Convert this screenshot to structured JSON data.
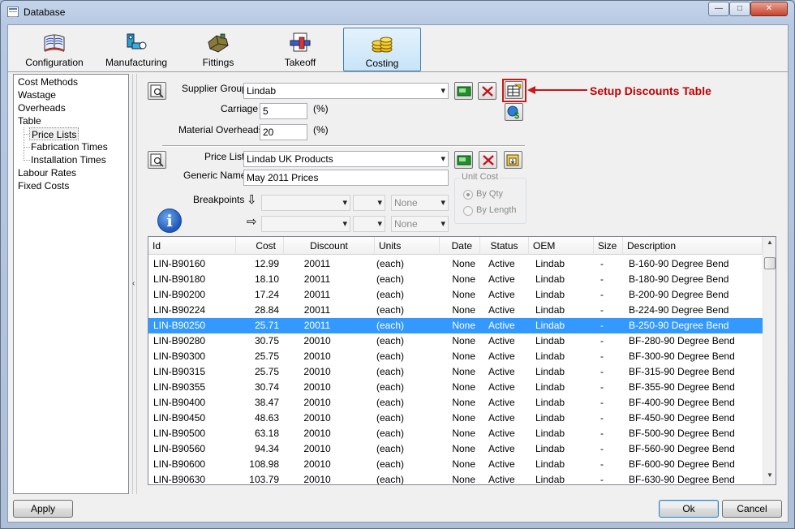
{
  "window": {
    "title": "Database",
    "min_glyph": "—",
    "max_glyph": "□",
    "close_glyph": "✕"
  },
  "toolbar": {
    "items": [
      {
        "label": "Configuration",
        "icon": "books-icon"
      },
      {
        "label": "Manufacturing",
        "icon": "manufacturing-icon"
      },
      {
        "label": "Fittings",
        "icon": "fittings-icon"
      },
      {
        "label": "Takeoff",
        "icon": "takeoff-icon"
      },
      {
        "label": "Costing",
        "icon": "coins-icon",
        "active": true
      }
    ]
  },
  "tree": {
    "items": [
      {
        "label": "Cost Methods"
      },
      {
        "label": "Wastage"
      },
      {
        "label": "Overheads"
      },
      {
        "label": "Table"
      },
      {
        "label": "Price Lists",
        "selected": true
      },
      {
        "label": "Fabrication Times"
      },
      {
        "label": "Installation Times"
      },
      {
        "label": "Labour Rates"
      },
      {
        "label": "Fixed Costs"
      }
    ],
    "splitter_glyph": "‹"
  },
  "supplier": {
    "group_label": "Supplier Group",
    "group_value": "Lindab",
    "carriage_label": "Carriage",
    "carriage_value": "5",
    "carriage_unit": "(%)",
    "overheads_label": "Material Overheads",
    "overheads_value": "20",
    "overheads_unit": "(%)"
  },
  "pricelist": {
    "label": "Price List",
    "value": "Lindab UK Products",
    "generic_label": "Generic Name",
    "generic_value": "May 2011 Prices",
    "breakpoints_label": "Breakpoints",
    "bp_down_glyph": "⇩",
    "bp_right_glyph": "⇨",
    "none1": "None",
    "none2": "None"
  },
  "unit_cost": {
    "title": "Unit Cost",
    "by_qty": "By Qty",
    "by_length": "By Length",
    "selected": "By Qty"
  },
  "info_glyph": "i",
  "grid": {
    "columns": [
      "Id",
      "Cost",
      "Discount",
      "Units",
      "Date",
      "Status",
      "OEM",
      "Size",
      "Description"
    ],
    "rows": [
      [
        "LIN-B90160",
        "12.99",
        "20011",
        "(each)",
        "None",
        "Active",
        "Lindab",
        "-",
        "B-160-90 Degree Bend"
      ],
      [
        "LIN-B90180",
        "18.10",
        "20011",
        "(each)",
        "None",
        "Active",
        "Lindab",
        "-",
        "B-180-90 Degree Bend"
      ],
      [
        "LIN-B90200",
        "17.24",
        "20011",
        "(each)",
        "None",
        "Active",
        "Lindab",
        "-",
        "B-200-90 Degree Bend"
      ],
      [
        "LIN-B90224",
        "28.84",
        "20011",
        "(each)",
        "None",
        "Active",
        "Lindab",
        "-",
        "B-224-90 Degree Bend"
      ],
      [
        "LIN-B90250",
        "25.71",
        "20011",
        "(each)",
        "None",
        "Active",
        "Lindab",
        "-",
        "B-250-90 Degree Bend"
      ],
      [
        "LIN-B90280",
        "30.75",
        "20010",
        "(each)",
        "None",
        "Active",
        "Lindab",
        "-",
        "BF-280-90 Degree Bend"
      ],
      [
        "LIN-B90300",
        "25.75",
        "20010",
        "(each)",
        "None",
        "Active",
        "Lindab",
        "-",
        "BF-300-90 Degree Bend"
      ],
      [
        "LIN-B90315",
        "25.75",
        "20010",
        "(each)",
        "None",
        "Active",
        "Lindab",
        "-",
        "BF-315-90 Degree Bend"
      ],
      [
        "LIN-B90355",
        "30.74",
        "20010",
        "(each)",
        "None",
        "Active",
        "Lindab",
        "-",
        "BF-355-90 Degree Bend"
      ],
      [
        "LIN-B90400",
        "38.47",
        "20010",
        "(each)",
        "None",
        "Active",
        "Lindab",
        "-",
        "BF-400-90 Degree Bend"
      ],
      [
        "LIN-B90450",
        "48.63",
        "20010",
        "(each)",
        "None",
        "Active",
        "Lindab",
        "-",
        "BF-450-90 Degree Bend"
      ],
      [
        "LIN-B90500",
        "63.18",
        "20010",
        "(each)",
        "None",
        "Active",
        "Lindab",
        "-",
        "BF-500-90 Degree Bend"
      ],
      [
        "LIN-B90560",
        "94.34",
        "20010",
        "(each)",
        "None",
        "Active",
        "Lindab",
        "-",
        "BF-560-90 Degree Bend"
      ],
      [
        "LIN-B90600",
        "108.98",
        "20010",
        "(each)",
        "None",
        "Active",
        "Lindab",
        "-",
        "BF-600-90 Degree Bend"
      ],
      [
        "LIN-B90630",
        "103.79",
        "20010",
        "(each)",
        "None",
        "Active",
        "Lindab",
        "-",
        "BF-630-90 Degree Bend"
      ]
    ],
    "selected_row": 4,
    "scroll_up_glyph": "▲",
    "scroll_down_glyph": "▼"
  },
  "buttons": {
    "apply": "Apply",
    "ok": "Ok",
    "cancel": "Cancel"
  },
  "annotation": {
    "text": "Setup Discounts Table",
    "color": "#c00000"
  },
  "colors": {
    "selection": "#3399ff",
    "active_tab": "#c8e4f8"
  }
}
